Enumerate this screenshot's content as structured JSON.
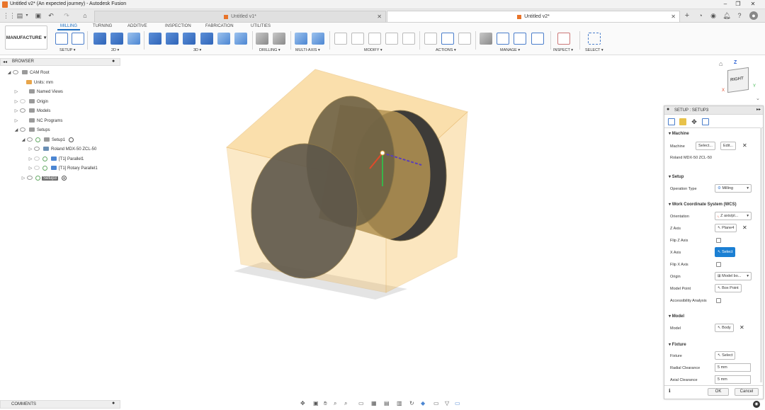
{
  "window": {
    "title": "Untitled v2* (An expected journey) - Autodesk Fusion"
  },
  "tabs": [
    {
      "label": "Untitled v1*"
    },
    {
      "label": "Untitled v2*"
    }
  ],
  "workspace": {
    "label": "MANUFACTURE"
  },
  "ribbon": {
    "tabs": [
      "MILLING",
      "TURNING",
      "ADDITIVE",
      "INSPECTION",
      "FABRICATION",
      "UTILITIES"
    ],
    "active_tab": "MILLING",
    "groups": [
      "SETUP",
      "2D",
      "3D",
      "DRILLING",
      "MULTI-AXIS",
      "MODIFY",
      "ACTIONS",
      "MANAGE",
      "INSPECT",
      "SELECT"
    ]
  },
  "browser": {
    "title": "BROWSER",
    "items": [
      {
        "label": "CAM Root"
      },
      {
        "label": "Units: mm"
      },
      {
        "label": "Named Views"
      },
      {
        "label": "Origin"
      },
      {
        "label": "Models"
      },
      {
        "label": "NC Programs"
      },
      {
        "label": "Setups"
      },
      {
        "label": "Setup1"
      },
      {
        "label": "Roland MDX-50 ZCL-50"
      },
      {
        "label": "[T1] Parallel1"
      },
      {
        "label": "[T1] Rotary Parallel1"
      },
      {
        "label": "Setup3"
      }
    ]
  },
  "comments": {
    "label": "COMMENTS"
  },
  "navcube": {
    "face": "RIGHT",
    "axis_z": "Z",
    "axis_y": "Y",
    "axis_x": "X"
  },
  "panel": {
    "title": "SETUP : SETUP3",
    "machine": {
      "section": "Machine",
      "label": "Machine",
      "select_btn": "Select...",
      "edit_btn": "Edit...",
      "value": "Roland MDX-50 ZCL-50"
    },
    "setup": {
      "section": "Setup",
      "op_label": "Operation Type",
      "op_value": "Milling"
    },
    "wcs": {
      "section": "Work Coordinate System (WCS)",
      "orientation_label": "Orientation",
      "orientation_value": "Z axis/pl...",
      "zaxis_label": "Z Axis",
      "zaxis_value": "Plane4",
      "flipz_label": "Flip Z Axis",
      "xaxis_label": "X Axis",
      "xaxis_value": "Select",
      "flipx_label": "Flip X Axis",
      "origin_label": "Origin",
      "origin_value": "Model bo...",
      "modelpoint_label": "Model Point",
      "modelpoint_value": "Box Point",
      "access_label": "Accessibility Analysis"
    },
    "model": {
      "section": "Model",
      "label": "Model",
      "value": "Body"
    },
    "fixture": {
      "section": "Fixture",
      "label": "Fixture",
      "value": "Select",
      "radial_label": "Radial Clearance",
      "radial_value": "5 mm",
      "axial_label": "Axial Clearance",
      "axial_value": "5 mm"
    },
    "ok": "OK",
    "cancel": "Cancel"
  },
  "colors": {
    "accent": "#1b7fd3",
    "stock": "#f5b94a",
    "brand": "#e8742a"
  }
}
